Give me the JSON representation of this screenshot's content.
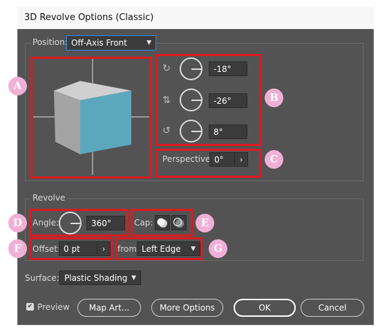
{
  "window": {
    "title": "3D Revolve Options (Classic)"
  },
  "position": {
    "label": "Position:",
    "value": "Off-Axis Front"
  },
  "rotation": {
    "x_value": "-18°",
    "y_value": "-26°",
    "z_value": "8°"
  },
  "perspective": {
    "label": "Perspective:",
    "value": "0°"
  },
  "revolve": {
    "title": "Revolve",
    "angle_label": "Angle:",
    "angle_value": "360°",
    "cap_label": "Cap:",
    "offset_label": "Offset:",
    "offset_value": "0 pt",
    "from_label": "from",
    "from_value": "Left Edge"
  },
  "surface": {
    "label": "Surface:",
    "value": "Plastic Shading"
  },
  "footer": {
    "preview_label": "Preview",
    "preview_checked": true,
    "map_art": "Map Art...",
    "more_options": "More Options",
    "ok": "OK",
    "cancel": "Cancel"
  },
  "annotations": [
    "A",
    "B",
    "C",
    "D",
    "E",
    "F",
    "G"
  ],
  "colors": {
    "accent": "#e0191f",
    "badge": "#f0b0d6",
    "cube_front": "#5ba8bd",
    "cube_side": "#a4a4a4",
    "cube_top": "#d0d0d0"
  },
  "icons": {
    "x_axis": "rotate-x-axis-icon",
    "y_axis": "rotate-y-axis-icon",
    "z_axis": "rotate-z-axis-icon",
    "cap_on": "cap-on-icon",
    "cap_off": "cap-off-icon"
  }
}
